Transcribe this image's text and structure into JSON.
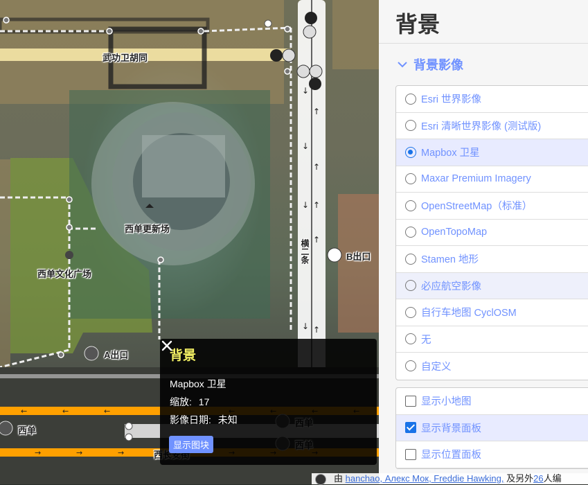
{
  "map": {
    "labels": {
      "street_wugong": "武功卫胡同",
      "xidan_gengxin": "西单更新场",
      "xidan_square": "西单文化广场",
      "exit_a": "A出口",
      "exit_b": "B出口",
      "street_vertical": "横二条",
      "xidan_left": "西单",
      "xidan_bottom": "西单",
      "xidan_bottom2": "西单",
      "xichang_road": "西长安街"
    }
  },
  "info_panel": {
    "title": "背景",
    "source": "Mapbox 卫星",
    "zoom_label": "缩放:",
    "zoom_value": "17",
    "date_label": "影像日期:",
    "date_value": "未知",
    "button_label": "显示图块"
  },
  "pane": {
    "title": "背景",
    "section": "背景影像",
    "layers": [
      {
        "label": "Esri 世界影像",
        "selected": false
      },
      {
        "label": "Esri 清晰世界影像 (测试版)",
        "selected": false
      },
      {
        "label": "Mapbox 卫星",
        "selected": true
      },
      {
        "label": "Maxar Premium Imagery",
        "selected": false
      },
      {
        "label": "OpenStreetMap（标准）",
        "selected": false
      },
      {
        "label": "OpenTopoMap",
        "selected": false
      },
      {
        "label": "Stamen 地形",
        "selected": false
      },
      {
        "label": "必应航空影像",
        "selected": false
      },
      {
        "label": "自行车地图 CyclOSM",
        "selected": false
      },
      {
        "label": "无",
        "selected": false
      },
      {
        "label": "自定义",
        "selected": false
      }
    ],
    "options": [
      {
        "label": "显示小地图",
        "checked": false
      },
      {
        "label": "显示背景面板",
        "checked": true
      },
      {
        "label": "显示位置面板",
        "checked": false
      }
    ]
  },
  "attribution": {
    "prefix": "由",
    "authors": "hanchao, Алекс Мок, Freddie Hawking,",
    "middle": "及另外",
    "count": "26",
    "suffix": "人编"
  }
}
